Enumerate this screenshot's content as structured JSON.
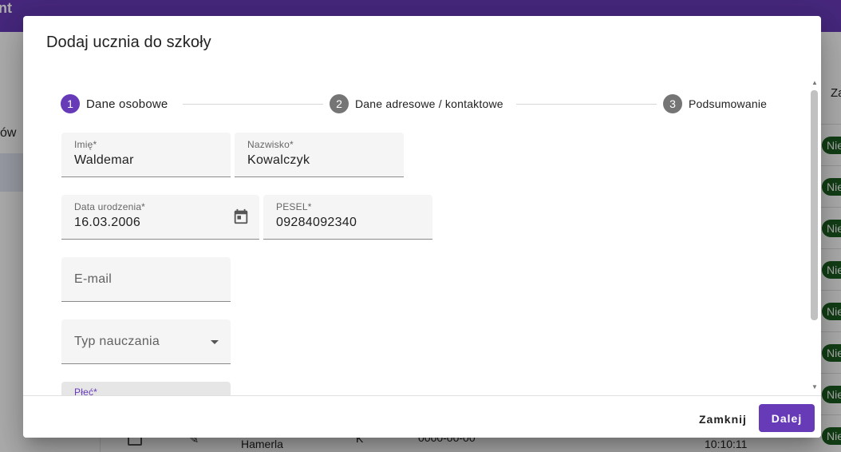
{
  "background": {
    "topbar_title": "nt",
    "sidebar_label": "ów",
    "column_header": "Za",
    "badges": [
      "Nie",
      "Nie",
      "Nie",
      "Nie",
      "Nie",
      "Nie",
      "Nie",
      "Nie"
    ],
    "bottom_row": {
      "name": "Hamerla",
      "gender": "K",
      "date": "0000-00-00",
      "time": "10:10:11"
    }
  },
  "dialog": {
    "title": "Dodaj ucznia do szkoły",
    "stepper": {
      "steps": [
        {
          "number": "1",
          "label": "Dane osobowe",
          "state": "active"
        },
        {
          "number": "2",
          "label": "Dane adresowe / kontaktowe",
          "state": "inactive"
        },
        {
          "number": "3",
          "label": "Podsumowanie",
          "state": "inactive"
        }
      ]
    },
    "form": {
      "first_name": {
        "label": "Imię*",
        "value": "Waldemar"
      },
      "last_name": {
        "label": "Nazwisko*",
        "value": "Kowalczyk"
      },
      "birth_date": {
        "label": "Data urodzenia*",
        "value": "16.03.2006",
        "icon": "calendar-icon"
      },
      "pesel": {
        "label": "PESEL*",
        "value": "09284092340"
      },
      "email": {
        "placeholder": "E-mail"
      },
      "teaching_type": {
        "placeholder": "Typ nauczania",
        "icon": "dropdown-arrow-icon"
      },
      "gender": {
        "label": "Płeć*"
      }
    },
    "actions": {
      "close_label": "Zamknij",
      "next_label": "Dalej"
    }
  },
  "colors": {
    "accent": "#673ab7",
    "badge_green": "#1b5e20",
    "step_inactive": "#757575"
  }
}
